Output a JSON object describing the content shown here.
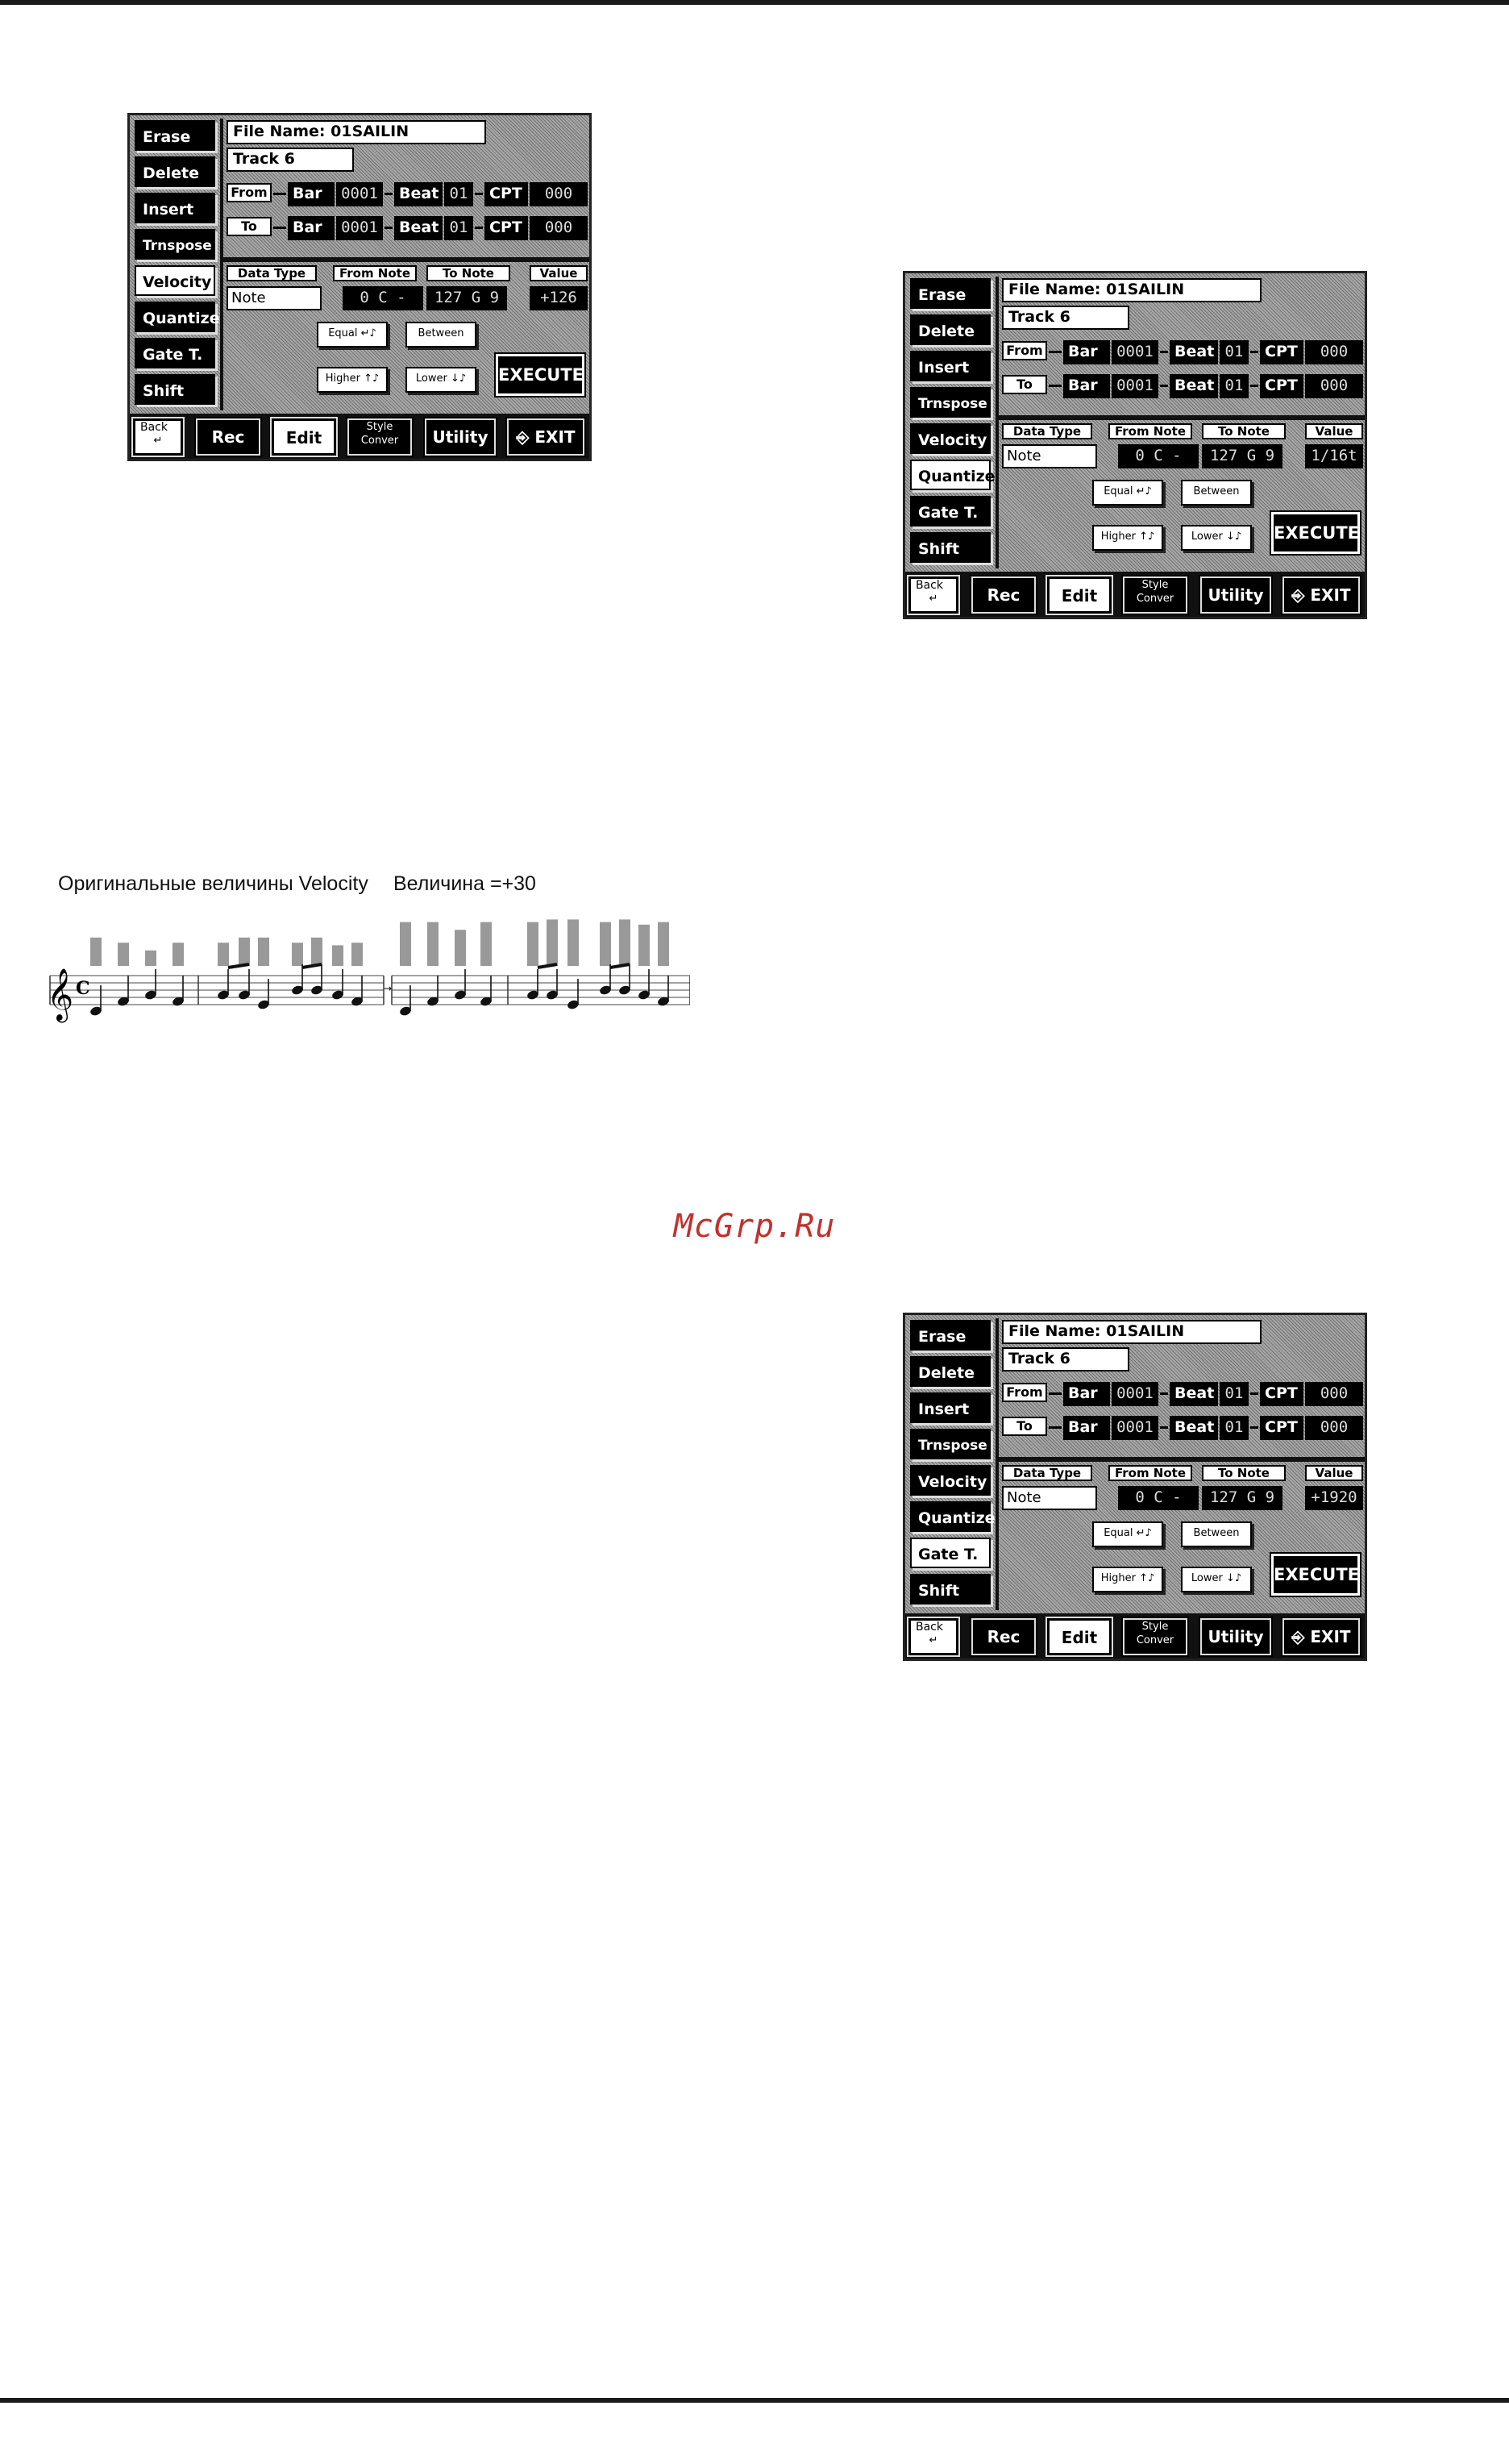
{
  "watermark": "McGrp.Ru",
  "screens": [
    {
      "file_name_label": "File Name:",
      "file_name": "01SAILIN",
      "track": "Track 6",
      "menu": [
        "Erase",
        "Delete",
        "Insert",
        "Trnspose",
        "Velocity",
        "Quantize",
        "Gate T.",
        "Shift"
      ],
      "active_menu": "Velocity",
      "from_label": "From",
      "to_label": "To",
      "bar_label": "Bar",
      "beat_label": "Beat",
      "cpt_label": "CPT",
      "from": {
        "bar": "0001",
        "beat": "01",
        "cpt": "000"
      },
      "to": {
        "bar": "0001",
        "beat": "01",
        "cpt": "000"
      },
      "headers": {
        "data_type": "Data Type",
        "from_note": "From Note",
        "to_note": "To Note",
        "value": "Value"
      },
      "data_type": "Note",
      "from_note": "0 C -",
      "to_note": "127 G 9",
      "value": "+126",
      "buttons": {
        "equal": "Equal",
        "between": "Between",
        "higher": "Higher",
        "lower": "Lower",
        "execute": "EXECUTE"
      },
      "bottom": {
        "back": "Back",
        "rec": "Rec",
        "edit": "Edit",
        "style_1": "Style",
        "style_2": "Conver",
        "utility": "Utility",
        "exit": "EXIT"
      }
    },
    {
      "file_name_label": "File Name:",
      "file_name": "01SAILIN",
      "track": "Track 6",
      "menu": [
        "Erase",
        "Delete",
        "Insert",
        "Trnspose",
        "Velocity",
        "Quantize",
        "Gate T.",
        "Shift"
      ],
      "active_menu": "Quantize",
      "from_label": "From",
      "to_label": "To",
      "bar_label": "Bar",
      "beat_label": "Beat",
      "cpt_label": "CPT",
      "from": {
        "bar": "0001",
        "beat": "01",
        "cpt": "000"
      },
      "to": {
        "bar": "0001",
        "beat": "01",
        "cpt": "000"
      },
      "headers": {
        "data_type": "Data Type",
        "from_note": "From Note",
        "to_note": "To Note",
        "value": "Value"
      },
      "data_type": "Note",
      "from_note": "0 C -",
      "to_note": "127 G 9",
      "value": "1/16t",
      "buttons": {
        "equal": "Equal",
        "between": "Between",
        "higher": "Higher",
        "lower": "Lower",
        "execute": "EXECUTE"
      },
      "bottom": {
        "back": "Back",
        "rec": "Rec",
        "edit": "Edit",
        "style_1": "Style",
        "style_2": "Conver",
        "utility": "Utility",
        "exit": "EXIT"
      }
    },
    {
      "file_name_label": "File Name:",
      "file_name": "01SAILIN",
      "track": "Track 6",
      "menu": [
        "Erase",
        "Delete",
        "Insert",
        "Trnspose",
        "Velocity",
        "Quantize",
        "Gate T.",
        "Shift"
      ],
      "active_menu": "Gate T.",
      "from_label": "From",
      "to_label": "To",
      "bar_label": "Bar",
      "beat_label": "Beat",
      "cpt_label": "CPT",
      "from": {
        "bar": "0001",
        "beat": "01",
        "cpt": "000"
      },
      "to": {
        "bar": "0001",
        "beat": "01",
        "cpt": "000"
      },
      "headers": {
        "data_type": "Data Type",
        "from_note": "From Note",
        "to_note": "To Note",
        "value": "Value"
      },
      "data_type": "Note",
      "from_note": "0 C -",
      "to_note": "127 G 9",
      "value": "+1920",
      "buttons": {
        "equal": "Equal",
        "between": "Between",
        "higher": "Higher",
        "lower": "Lower",
        "execute": "EXECUTE"
      },
      "bottom": {
        "back": "Back",
        "rec": "Rec",
        "edit": "Edit",
        "style_1": "Style",
        "style_2": "Conver",
        "utility": "Utility",
        "exit": "EXIT"
      }
    }
  ],
  "figure": {
    "caption_left": "Оригинальные величины Velocity",
    "caption_right": "Величина =+30",
    "velocity_original": [
      0.55,
      0.45,
      0.3,
      0.45,
      0.45,
      0.55,
      0.55,
      0.45,
      0.55,
      0.4,
      0.45
    ],
    "velocity_after": [
      0.85,
      0.85,
      0.7,
      0.85,
      0.85,
      0.9,
      0.9,
      0.85,
      0.9,
      0.8,
      0.85
    ],
    "bar_color": "#999999"
  }
}
